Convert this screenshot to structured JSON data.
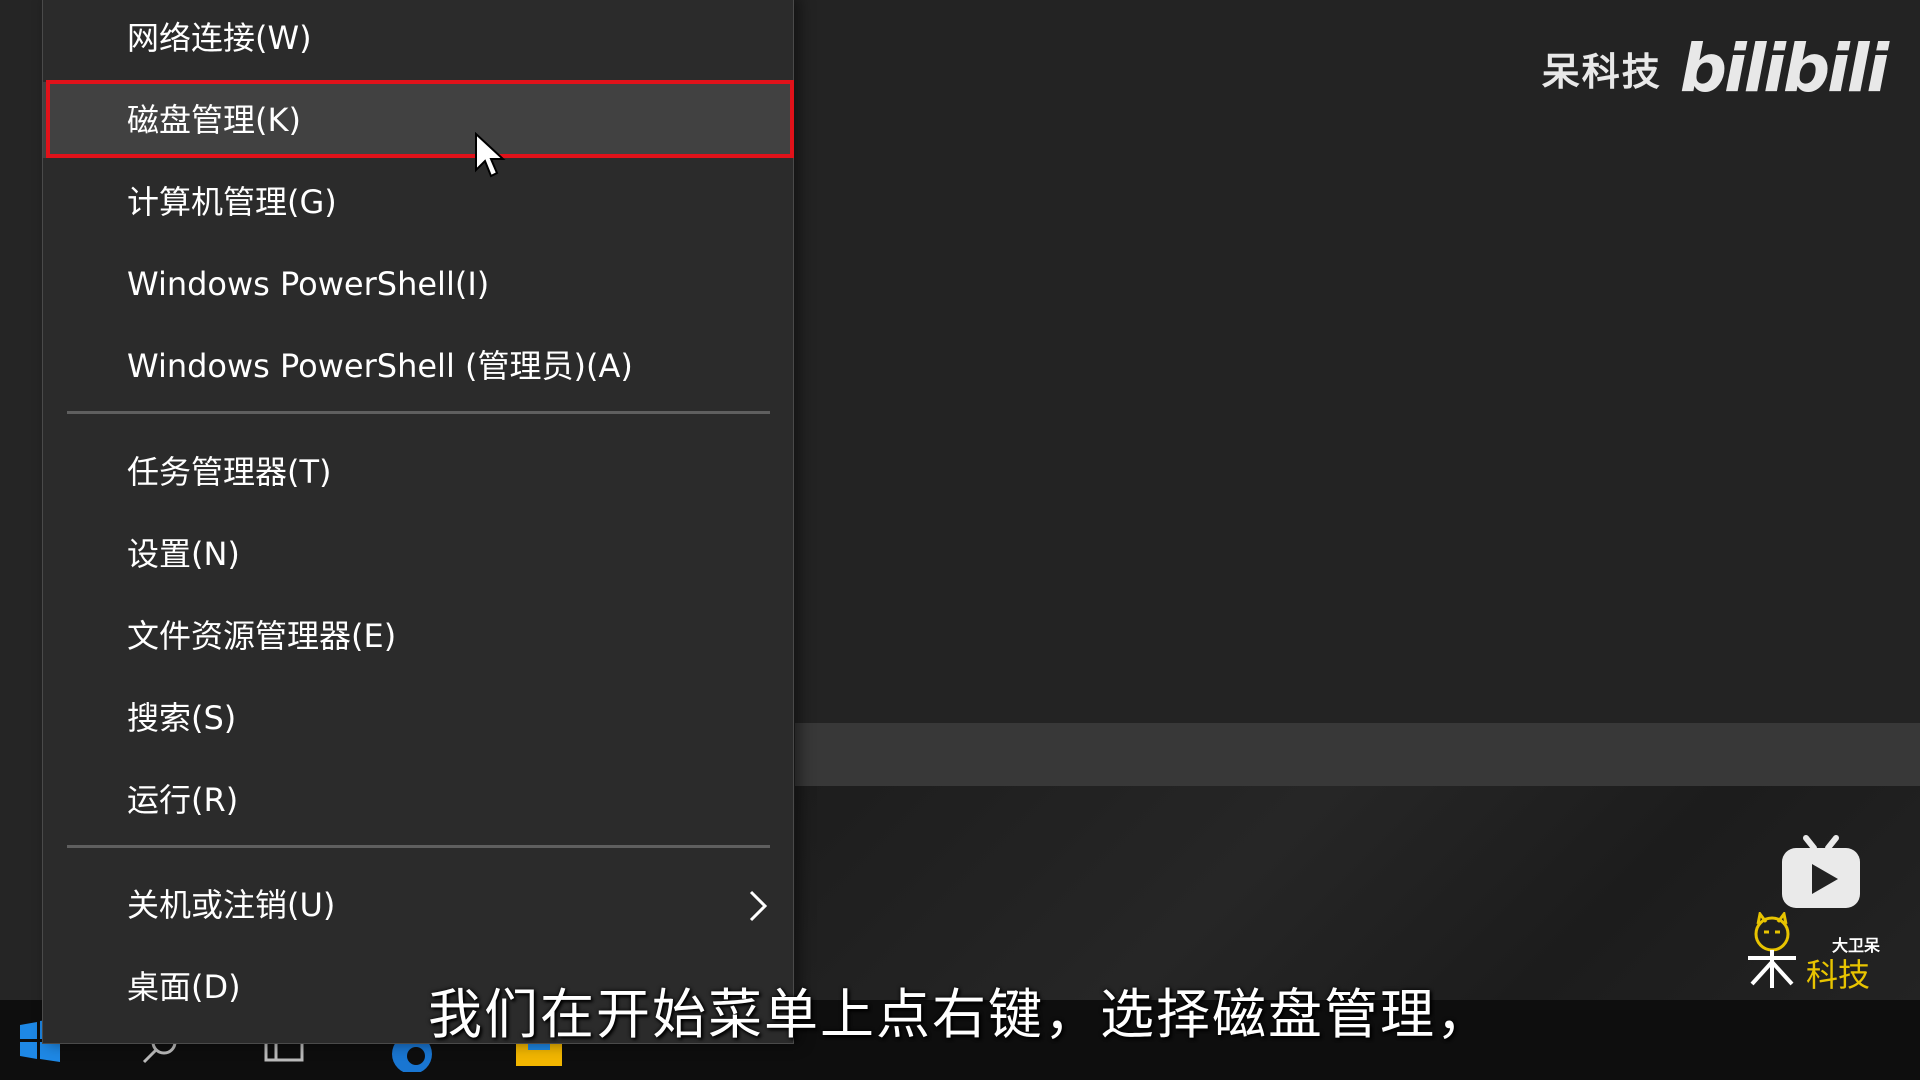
{
  "watermark": {
    "text": "呆科技",
    "logo": "bilibili"
  },
  "context_menu": {
    "items": [
      {
        "label": "网络连接(W)"
      },
      {
        "label": "磁盘管理(K)",
        "highlighted": true
      },
      {
        "label": "计算机管理(G)"
      },
      {
        "label": "Windows PowerShell(I)"
      },
      {
        "label": "Windows PowerShell (管理员)(A)"
      },
      {
        "label": "任务管理器(T)"
      },
      {
        "label": "设置(N)"
      },
      {
        "label": "文件资源管理器(E)"
      },
      {
        "label": "搜索(S)"
      },
      {
        "label": "运行(R)"
      },
      {
        "label": "关机或注销(U)",
        "has_submenu": true
      },
      {
        "label": "桌面(D)"
      }
    ]
  },
  "channel_logo": {
    "top": "大卫呆",
    "bottom": "科技"
  },
  "subtitle": "我们在开始菜单上点右键，选择磁盘管理，",
  "colors": {
    "highlight_border": "#e0121a",
    "menu_bg": "#2b2b2b",
    "channel_yellow": "#e8c400"
  },
  "taskbar_icons": [
    "windows-start-icon",
    "search-icon",
    "task-view-icon",
    "edge-icon",
    "file-explorer-icon"
  ]
}
